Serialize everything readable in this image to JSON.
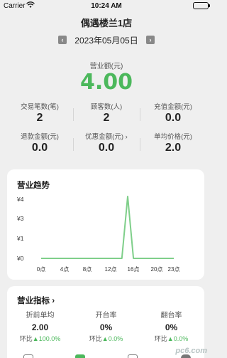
{
  "status_bar": {
    "carrier": "Carrier",
    "time": "10:24 AM"
  },
  "header": {
    "store_name": "偶遇楼兰1店",
    "date": "2023年05月05日"
  },
  "revenue": {
    "label": "营业额(元)",
    "value": "4.00"
  },
  "metrics": [
    {
      "label": "交易笔数(笔)",
      "value": "2"
    },
    {
      "label": "顾客数(人)",
      "value": "2"
    },
    {
      "label": "充值金额(元)",
      "value": "0.0"
    },
    {
      "label": "退款金额(元)",
      "value": "0.0"
    },
    {
      "label": "优惠金额(元) ›",
      "value": "0.0"
    },
    {
      "label": "单均价格(元)",
      "value": "2.0"
    }
  ],
  "trend": {
    "title": "营业趋势",
    "y_ticks": [
      "¥4",
      "¥3",
      "¥1",
      "¥0"
    ],
    "x_ticks": [
      "0点",
      "4点",
      "8点",
      "12点",
      "16点",
      "20点",
      "23点"
    ]
  },
  "chart_data": {
    "type": "line",
    "x": [
      0,
      14,
      15,
      16,
      23
    ],
    "y": [
      0,
      0,
      4,
      0,
      0
    ],
    "xlim": [
      0,
      23
    ],
    "ylim": [
      0,
      4
    ],
    "color": "#7fcf8a"
  },
  "indicators": {
    "title": "营业指标 ›",
    "items": [
      {
        "label": "折前单均",
        "value": "2.00",
        "change_prefix": "环比",
        "change": "100.0%"
      },
      {
        "label": "开台率",
        "value": "0%",
        "change_prefix": "环比",
        "change": "0.0%"
      },
      {
        "label": "翻台率",
        "value": "0%",
        "change_prefix": "环比",
        "change": "0.0%"
      }
    ]
  },
  "watermark": "pc6.com"
}
